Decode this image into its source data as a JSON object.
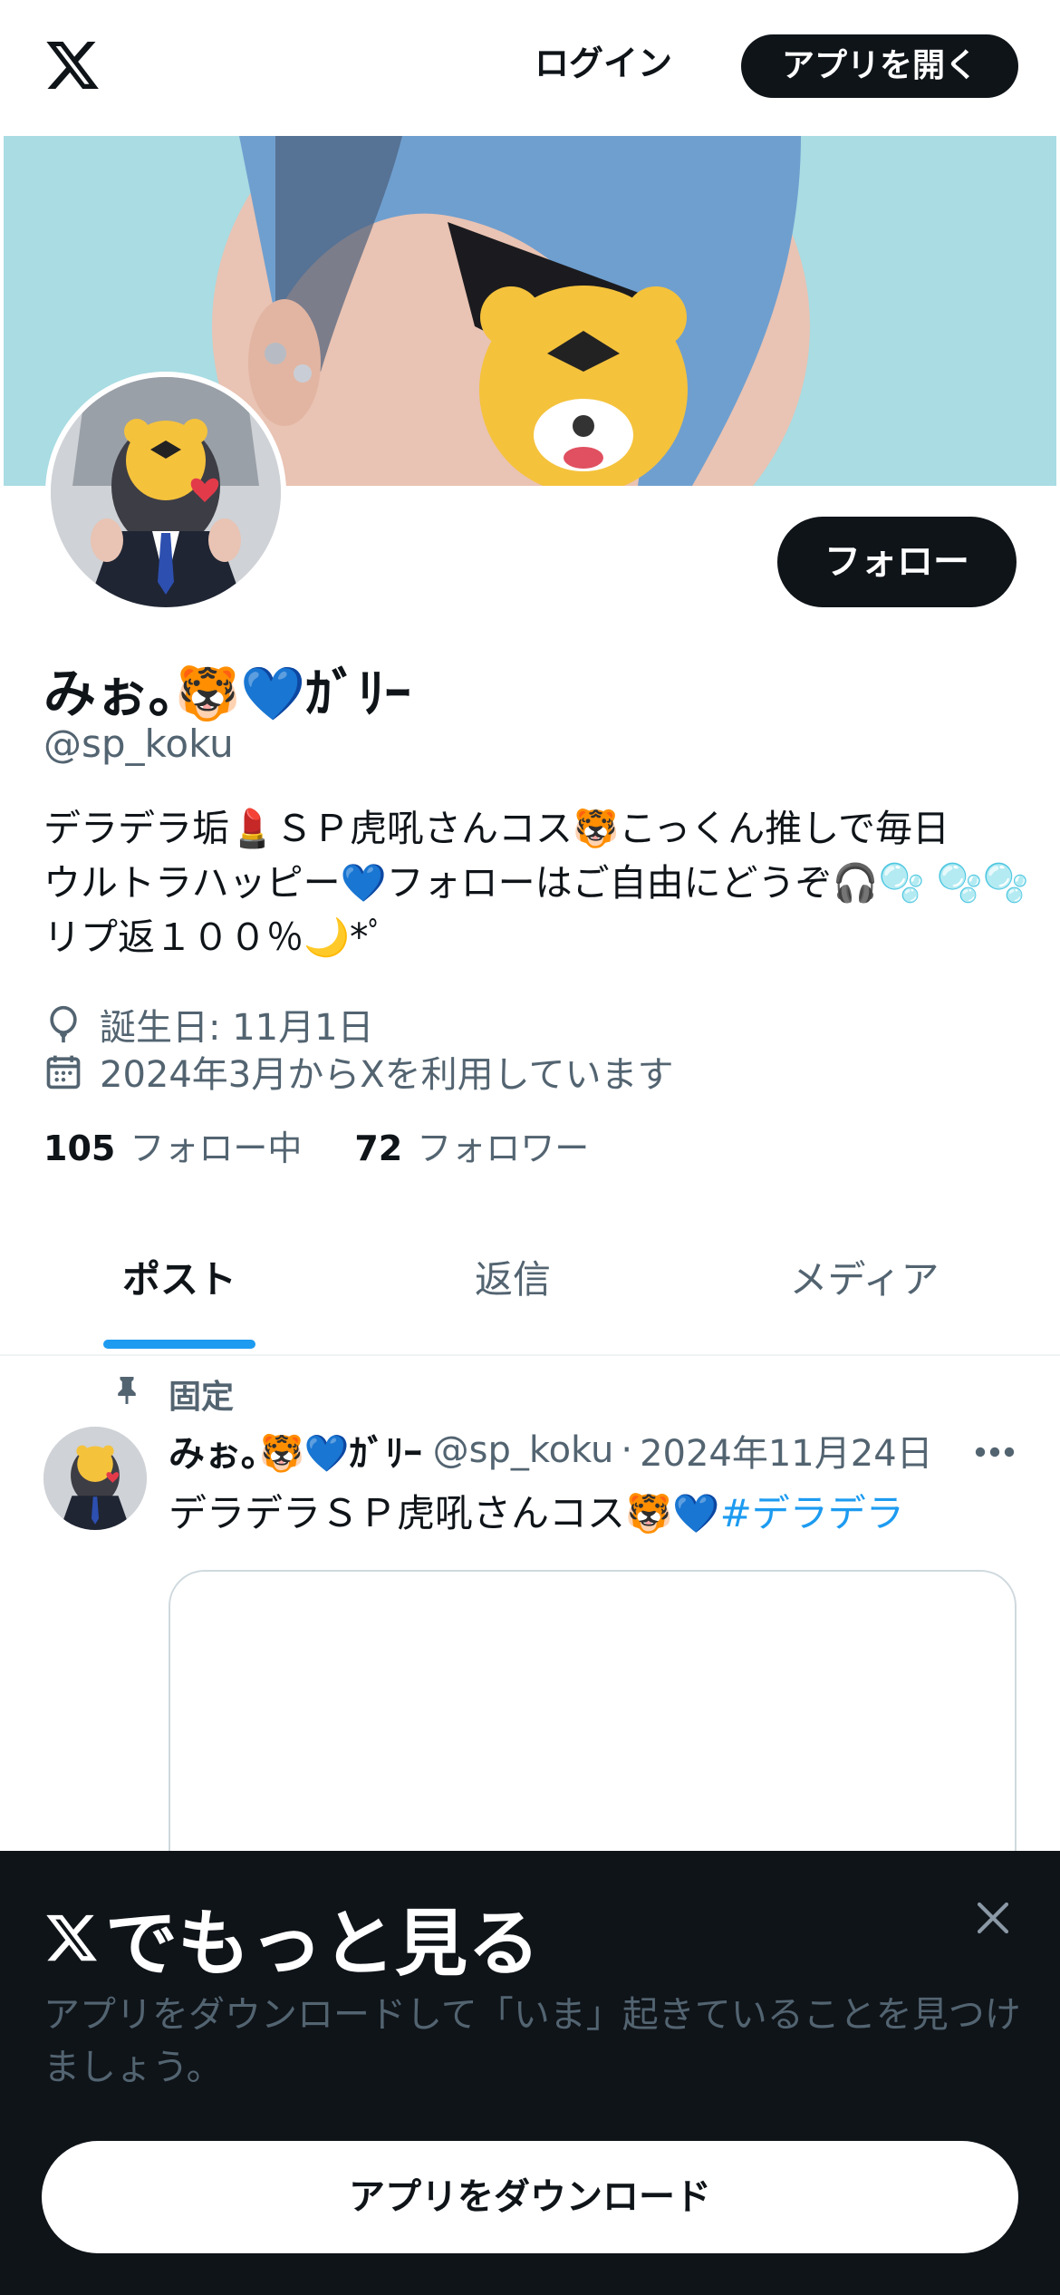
{
  "topbar": {
    "logo_icon": "x-logo-icon",
    "login_label": "ログイン",
    "open_app_label": "アプリを開く"
  },
  "profile": {
    "banner_image": "profile-banner",
    "avatar_image": "profile-avatar",
    "follow_label": "フォロー",
    "display_name": "みぉ｡🐯💙ｶﾞﾘｰ",
    "handle": "@sp_koku",
    "bio_lines": [
      "デラデラ垢💄ＳＰ虎吼さんコス🐯こっくん推しで毎日",
      "ウルトラハッピー💙フォローはご自由にどうぞ🎧🫧 🫧🫧",
      "リプ返１００％🌙*ﾟ"
    ],
    "birthday": "誕生日: 11月1日",
    "joined": "2024年3月からXを利用しています",
    "following_count": "105",
    "following_label": "フォロー中",
    "followers_count": "72",
    "followers_label": "フォロワー"
  },
  "tabs": [
    {
      "label": "ポスト",
      "active": true
    },
    {
      "label": "返信",
      "active": false
    },
    {
      "label": "メディア",
      "active": false
    }
  ],
  "post": {
    "pinned_label": "固定",
    "name": "みぉ｡🐯💙ｶﾞﾘｰ",
    "handle": "@sp_koku",
    "separator": "·",
    "date": "2024年11月24日",
    "text": "デラデラＳＰ虎吼さんコス🐯💙",
    "hashtag": "#デラデラ"
  },
  "sheet": {
    "title": "でもっと見る",
    "description": "アプリをダウンロードして「いま」起きていることを見つけましょう。",
    "download_label": "アプリをダウンロード"
  },
  "colors": {
    "accent": "#1d9bf0",
    "text_primary": "#0f1419",
    "text_secondary": "#536471",
    "sheet_bg": "#0f1419"
  }
}
